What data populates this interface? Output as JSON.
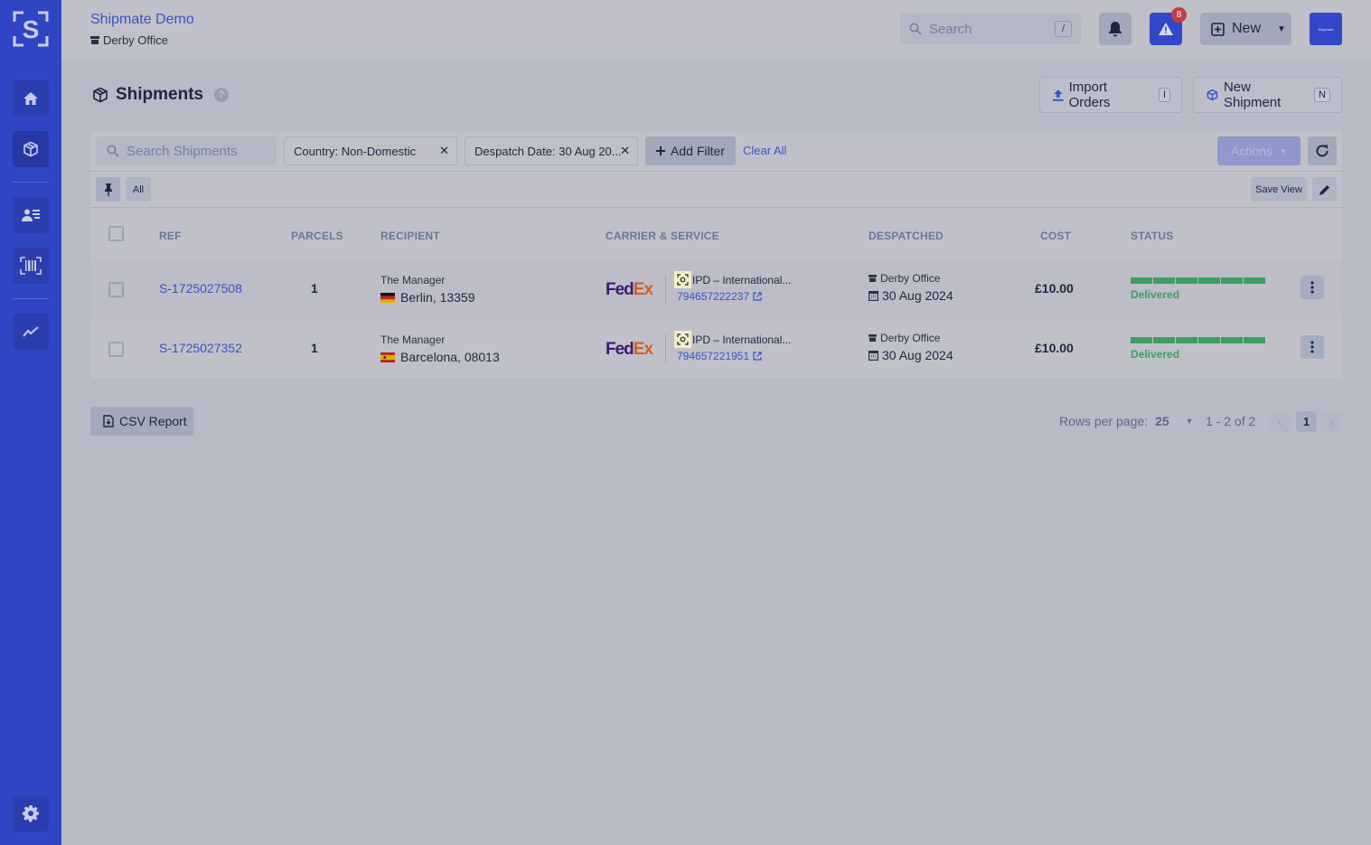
{
  "app": {
    "title": "Shipmate Demo",
    "office": "Derby Office",
    "brand_color": "#2f46c4"
  },
  "sidebar": {
    "items": [
      {
        "name": "home",
        "icon": "home-icon"
      },
      {
        "name": "shipments",
        "icon": "box-icon",
        "active": true
      },
      {
        "name": "contacts",
        "icon": "contact-list-icon"
      },
      {
        "name": "scan",
        "icon": "barcode-icon"
      },
      {
        "name": "analytics",
        "icon": "chart-line-icon"
      }
    ],
    "settings_icon": "gear-icon"
  },
  "topbar": {
    "search_placeholder": "Search",
    "search_shortcut": "/",
    "alert_count": "8",
    "new_label": "New",
    "avatar_text": "Shipmate"
  },
  "page": {
    "title": "Shipments",
    "help": "?",
    "import_label": "Import Orders",
    "import_key": "I",
    "new_shipment_label": "New Shipment",
    "new_shipment_key": "N"
  },
  "filters": {
    "search_placeholder": "Search Shipments",
    "chips": [
      {
        "label": "Country: Non-Domestic"
      },
      {
        "label": "Despatch Date: 30 Aug 20..."
      }
    ],
    "add_filter_label": "Add Filter",
    "clear_all_label": "Clear All",
    "actions_label": "Actions"
  },
  "views": {
    "current": "All",
    "save_view_label": "Save View"
  },
  "table": {
    "columns": [
      "REF",
      "PARCELS",
      "RECIPIENT",
      "CARRIER & SERVICE",
      "DESPATCHED",
      "COST",
      "STATUS"
    ],
    "rows": [
      {
        "ref": "S-1725027508",
        "parcels": "1",
        "recipient_name": "The Manager",
        "recipient_city": "Berlin, 13359",
        "country": "DE",
        "carrier": "FedEx",
        "service": "IPD – International...",
        "tracking": "794657222237",
        "despatch_office": "Derby Office",
        "despatch_date": "30 Aug 2024",
        "cost": "£10.00",
        "status": "Delivered",
        "progress_fraction": 1.0
      },
      {
        "ref": "S-1725027352",
        "parcels": "1",
        "recipient_name": "The Manager",
        "recipient_city": "Barcelona, 08013",
        "country": "ES",
        "carrier": "FedEx",
        "service": "IPD – International...",
        "tracking": "794657221951",
        "despatch_office": "Derby Office",
        "despatch_date": "30 Aug 2024",
        "cost": "£10.00",
        "status": "Delivered",
        "progress_fraction": 1.0
      }
    ]
  },
  "footer": {
    "csv_label": "CSV Report",
    "rows_per_page_label": "Rows per page:",
    "rows_per_page": "25",
    "range": "1 - 2 of 2",
    "current_page": "1"
  }
}
